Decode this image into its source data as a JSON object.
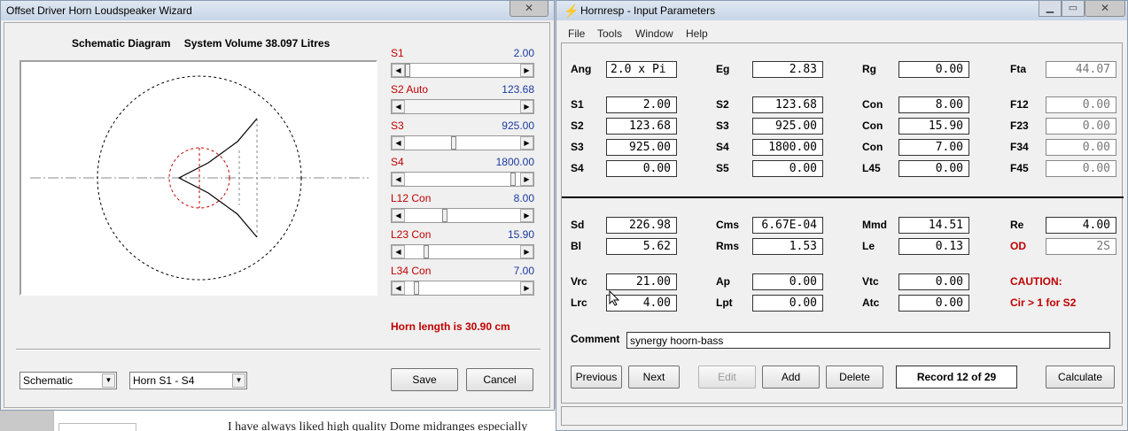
{
  "background": {
    "text": "I have always liked high quality Dome midranges especially"
  },
  "wizard": {
    "title": "Offset Driver Horn Loudspeaker Wizard",
    "close": "✕",
    "heading_left": "Schematic Diagram",
    "heading_right": "System Volume 38.097 Litres",
    "sliders": [
      {
        "label": "S1",
        "value": "2.00",
        "fraction": 0.0
      },
      {
        "label": "S2 Auto",
        "value": "123.68",
        "fraction": 0.0
      },
      {
        "label": "S3",
        "value": "925.00",
        "fraction": 0.42
      },
      {
        "label": "S4",
        "value": "1800.00",
        "fraction": 0.96
      },
      {
        "label": "L12 Con",
        "value": "8.00",
        "fraction": 0.34
      },
      {
        "label": "L23 Con",
        "value": "15.90",
        "fraction": 0.17
      },
      {
        "label": "L34 Con",
        "value": "7.00",
        "fraction": 0.08
      }
    ],
    "horn_length": "Horn length is 30.90 cm",
    "view_select": "Schematic",
    "horn_select": "Horn S1 - S4",
    "save_label": "Save",
    "cancel_label": "Cancel"
  },
  "hornresp": {
    "title": "Hornresp - Input Parameters",
    "menu": [
      "File",
      "Tools",
      "Window",
      "Help"
    ],
    "fields": {
      "ang": {
        "label": "Ang",
        "value": "2.0 x Pi"
      },
      "eg": {
        "label": "Eg",
        "value": "2.83"
      },
      "rg": {
        "label": "Rg",
        "value": "0.00"
      },
      "fta": {
        "label": "Fta",
        "value": "44.07"
      },
      "s1a": {
        "label": "S1",
        "value": "2.00"
      },
      "s2a": {
        "label": "S2",
        "value": "123.68"
      },
      "con1": {
        "label": "Con",
        "value": "8.00"
      },
      "f12": {
        "label": "F12",
        "value": "0.00"
      },
      "s2b": {
        "label": "S2",
        "value": "123.68"
      },
      "s3a": {
        "label": "S3",
        "value": "925.00"
      },
      "con2": {
        "label": "Con",
        "value": "15.90"
      },
      "f23": {
        "label": "F23",
        "value": "0.00"
      },
      "s3b": {
        "label": "S3",
        "value": "925.00"
      },
      "s4a": {
        "label": "S4",
        "value": "1800.00"
      },
      "con3": {
        "label": "Con",
        "value": "7.00"
      },
      "f34": {
        "label": "F34",
        "value": "0.00"
      },
      "s4b": {
        "label": "S4",
        "value": "0.00"
      },
      "s5": {
        "label": "S5",
        "value": "0.00"
      },
      "l45": {
        "label": "L45",
        "value": "0.00"
      },
      "f45": {
        "label": "F45",
        "value": "0.00"
      },
      "sd": {
        "label": "Sd",
        "value": "226.98"
      },
      "cms": {
        "label": "Cms",
        "value": "6.67E-04"
      },
      "mmd": {
        "label": "Mmd",
        "value": "14.51"
      },
      "re": {
        "label": "Re",
        "value": "4.00"
      },
      "bl": {
        "label": "Bl",
        "value": "5.62"
      },
      "rms": {
        "label": "Rms",
        "value": "1.53"
      },
      "le": {
        "label": "Le",
        "value": "0.13"
      },
      "od": {
        "label": "OD",
        "value": "2S"
      },
      "vrc": {
        "label": "Vrc",
        "value": "21.00"
      },
      "ap": {
        "label": "Ap",
        "value": "0.00"
      },
      "vtc": {
        "label": "Vtc",
        "value": "0.00"
      },
      "lrc": {
        "label": "Lrc",
        "value": "4.00"
      },
      "lpt": {
        "label": "Lpt",
        "value": "0.00"
      },
      "atc": {
        "label": "Atc",
        "value": "0.00"
      }
    },
    "caution_title": "CAUTION:",
    "caution_text": "Cir > 1 for S2",
    "comment_label": "Comment",
    "comment_value": "synergy hoorn-bass",
    "buttons": {
      "previous": "Previous",
      "next": "Next",
      "edit": "Edit",
      "add": "Add",
      "delete": "Delete",
      "calculate": "Calculate"
    },
    "record": "Record 12 of 29"
  },
  "colors": {
    "label_red": "#c00000",
    "value_blue": "#1a3aa0"
  }
}
